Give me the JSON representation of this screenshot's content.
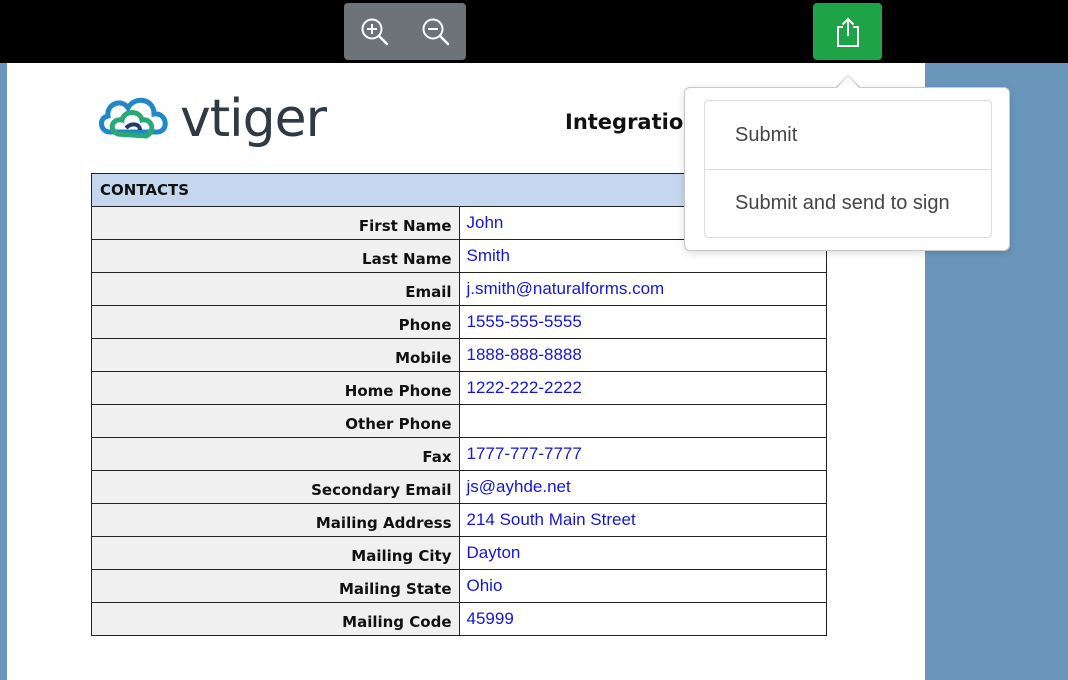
{
  "toolbar": {
    "zoom_in_icon": "zoom-in-icon",
    "zoom_out_icon": "zoom-out-icon",
    "share_icon": "share-icon",
    "share_color": "#1ea446"
  },
  "document": {
    "logo_text": "vtiger",
    "title": "Integratio",
    "section_header": "CONTACTS",
    "rows": [
      {
        "label": "First Name",
        "value": "John"
      },
      {
        "label": "Last Name",
        "value": "Smith"
      },
      {
        "label": "Email",
        "value": "j.smith@naturalforms.com"
      },
      {
        "label": "Phone",
        "value": "1555-555-5555"
      },
      {
        "label": "Mobile",
        "value": "1888-888-8888"
      },
      {
        "label": "Home Phone",
        "value": "1222-222-2222"
      },
      {
        "label": "Other Phone",
        "value": ""
      },
      {
        "label": "Fax",
        "value": "1777-777-7777"
      },
      {
        "label": "Secondary Email",
        "value": "js@ayhde.net"
      },
      {
        "label": "Mailing Address",
        "value": "214 South Main Street"
      },
      {
        "label": "Mailing City",
        "value": "Dayton"
      },
      {
        "label": "Mailing State",
        "value": "Ohio"
      },
      {
        "label": "Mailing Code",
        "value": "45999"
      }
    ]
  },
  "popover": {
    "items": [
      {
        "label": "Submit"
      },
      {
        "label": "Submit and send to sign"
      }
    ]
  }
}
